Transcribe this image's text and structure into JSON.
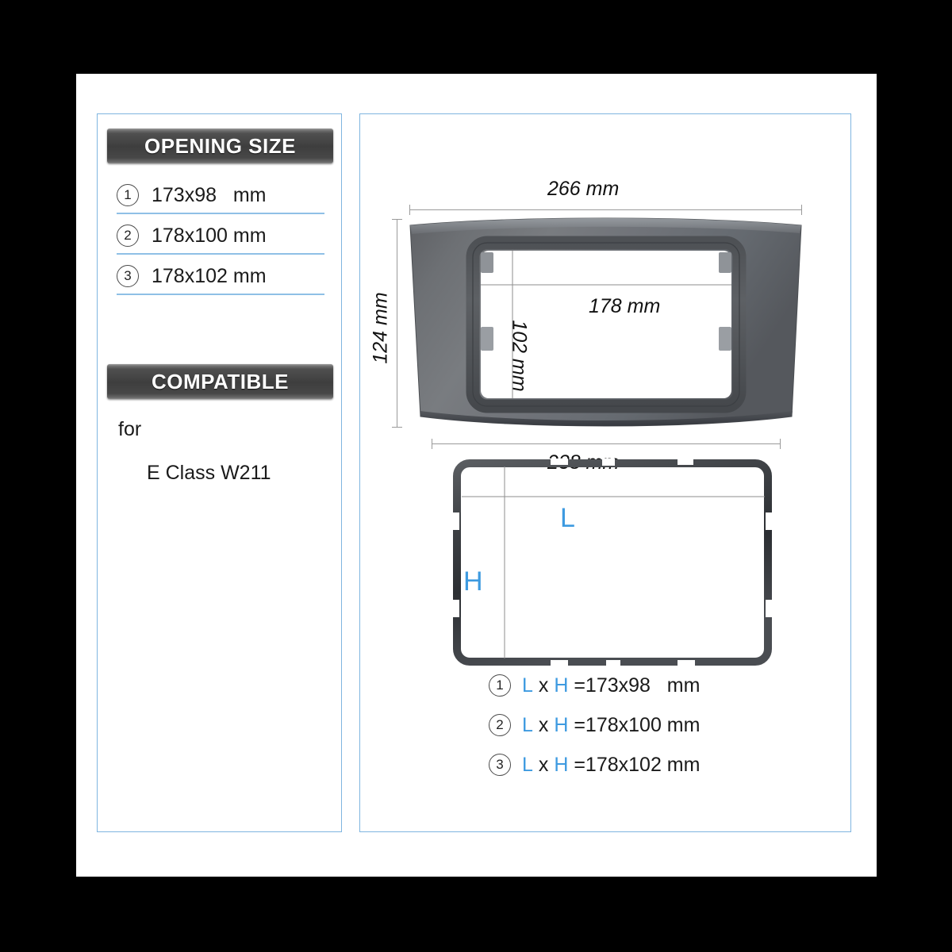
{
  "page": {
    "background_color": "#000000",
    "sheet_color": "#ffffff",
    "panel_border_color": "#7fb5e0",
    "accent_blue": "#3d9ae0",
    "separator_blue": "#8fc0e6",
    "banner_dark": "#3e3e3e",
    "product_grey": "#6a6a6a"
  },
  "left_panel": {
    "opening_banner": "OPENING SIZE",
    "compatible_banner": "COMPATIBLE",
    "sizes": [
      {
        "index": "1",
        "value": "173x98   mm"
      },
      {
        "index": "2",
        "value": "178x100 mm"
      },
      {
        "index": "3",
        "value": "178x102 mm"
      }
    ],
    "compatible_for": "for",
    "compatible_model": "E Class W211"
  },
  "right_panel": {
    "fascia_dimensions": {
      "top_width": "266 mm",
      "bottom_width": "238 mm",
      "height": "124 mm",
      "opening_width": "178 mm",
      "opening_height": "102 mm"
    },
    "bezel_labels": {
      "length": "L",
      "height": "H"
    },
    "legend": [
      {
        "index": "1",
        "l": "L",
        "x": " x ",
        "h": "H",
        "eq": " =173x98   mm"
      },
      {
        "index": "2",
        "l": "L",
        "x": " x ",
        "h": "H",
        "eq": " =178x100 mm"
      },
      {
        "index": "3",
        "l": "L",
        "x": " x ",
        "h": "H",
        "eq": " =178x102 mm"
      }
    ]
  }
}
